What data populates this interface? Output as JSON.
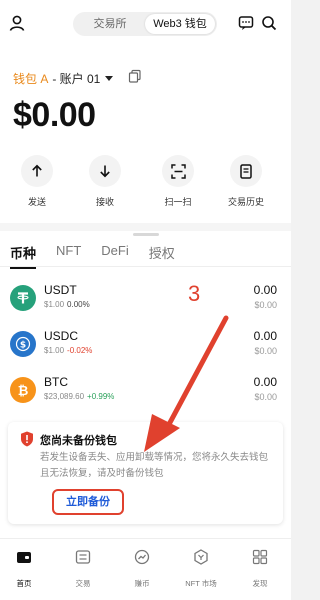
{
  "header": {
    "tabs": [
      "交易所",
      "Web3 钱包"
    ],
    "active_tab": "Web3 钱包",
    "icons": [
      "user-icon",
      "message-icon",
      "search-icon"
    ]
  },
  "wallet": {
    "name": "钱包 A",
    "account": "- 账户 01",
    "balance": "$0.00"
  },
  "actions": [
    {
      "label": "发送",
      "icon": "arrow-up-icon"
    },
    {
      "label": "接收",
      "icon": "arrow-down-icon"
    },
    {
      "label": "扫一扫",
      "icon": "scan-icon"
    },
    {
      "label": "交易历史",
      "icon": "history-icon"
    }
  ],
  "asset_tabs": [
    "币种",
    "NFT",
    "DeFi",
    "授权"
  ],
  "assets": [
    {
      "symbol": "USDT",
      "price": "$1.00",
      "change": "0.00%",
      "amount": "0.00",
      "value": "$0.00"
    },
    {
      "symbol": "USDC",
      "price": "$1.00",
      "change": "-0.02%",
      "amount": "0.00",
      "value": "$0.00"
    },
    {
      "symbol": "BTC",
      "price": "$23,089.60",
      "change": "+0.99%",
      "amount": "0.00",
      "value": "$0.00"
    }
  ],
  "annotation": {
    "step_number": "3"
  },
  "backup_card": {
    "title": "您尚未备份钱包",
    "body": "若发生设备丢失、应用卸载等情况，您将永久失去钱包且无法恢复，请及时备份钱包",
    "button": "立即备份"
  },
  "bottom_nav": [
    {
      "label": "首页",
      "icon": "wallet-icon",
      "active": true
    },
    {
      "label": "交易",
      "icon": "trade-icon"
    },
    {
      "label": "赚币",
      "icon": "earn-icon"
    },
    {
      "label": "NFT 市场",
      "icon": "nft-icon"
    },
    {
      "label": "发现",
      "icon": "discover-icon"
    }
  ],
  "colors": {
    "accent_orange": "#e9891b",
    "annotation_red": "#e0412e",
    "link_blue": "#1f5bd8",
    "usdt": "#26a17b",
    "usdc": "#2775ca",
    "btc": "#f7931a",
    "positive": "#2ba15b",
    "negative": "#e0412e"
  }
}
